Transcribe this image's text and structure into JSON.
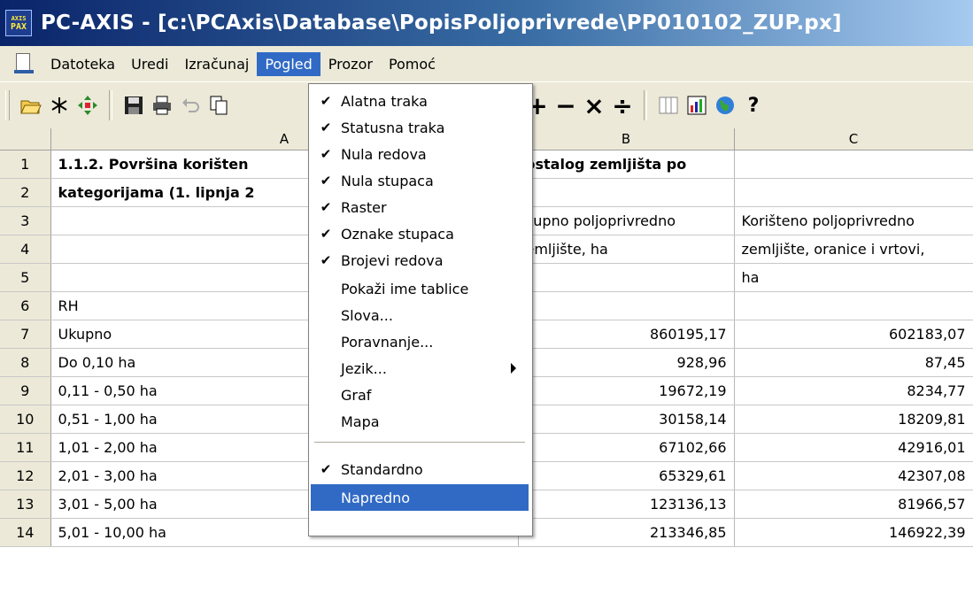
{
  "window": {
    "icon_text_top": "AXIS",
    "icon_text_bottom": "PAX",
    "title": "PC-AXIS - [c:\\PCAxis\\Database\\PopisPoljoprivrede\\PP010102_ZUP.px]"
  },
  "menubar": {
    "items": [
      "Datoteka",
      "Uredi",
      "Izračunaj",
      "Pogled",
      "Prozor",
      "Pomoć"
    ],
    "active": "Pogled"
  },
  "toolbar": {
    "text_buttons": {
      "percent": "%",
      "permille": "‰",
      "plus": "+",
      "minus": "−",
      "multiply": "×",
      "divide": "÷",
      "help": "?"
    }
  },
  "grid": {
    "column_headers": [
      "A",
      "B",
      "C"
    ],
    "rows": [
      {
        "n": "1",
        "a": "1.1.2. Površina korišten",
        "b": "ostalog zemljišta po",
        "c": "",
        "bold": true
      },
      {
        "n": "2",
        "a": "kategorijama (1. lipnja 2",
        "b": "",
        "c": "",
        "bold": true
      },
      {
        "n": "3",
        "a": "",
        "b": "kupno poljoprivredno",
        "c": "Korišteno poljoprivredno",
        "bold": false
      },
      {
        "n": "4",
        "a": "",
        "b": "emljište, ha",
        "c": "zemljište, oranice i vrtovi,",
        "bold": false
      },
      {
        "n": "5",
        "a": "",
        "b": "",
        "c": "ha",
        "bold": false
      },
      {
        "n": "6",
        "a": "RH",
        "b": "",
        "c": "",
        "bold": false
      },
      {
        "n": "7",
        "a": "Ukupno",
        "b": "860195,17",
        "c": "602183,07",
        "bold": false
      },
      {
        "n": "8",
        "a": "Do 0,10 ha",
        "b": "928,96",
        "c": "87,45",
        "bold": false
      },
      {
        "n": "9",
        "a": "0,11 - 0,50 ha",
        "b": "19672,19",
        "c": "8234,77",
        "bold": false
      },
      {
        "n": "10",
        "a": "0,51 - 1,00 ha",
        "b": "30158,14",
        "c": "18209,81",
        "bold": false
      },
      {
        "n": "11",
        "a": "1,01 - 2,00 ha",
        "b": "67102,66",
        "c": "42916,01",
        "bold": false
      },
      {
        "n": "12",
        "a": "2,01 - 3,00 ha",
        "b": "65329,61",
        "c": "42307,08",
        "bold": false
      },
      {
        "n": "13",
        "a": "3,01 - 5,00 ha",
        "b": "123136,13",
        "c": "81966,57",
        "bold": false
      },
      {
        "n": "14",
        "a": "5,01 - 10,00 ha",
        "b": "213346,85",
        "c": "146922,39",
        "bold": false
      }
    ]
  },
  "dropdown": {
    "check_glyph": "✔",
    "items": [
      {
        "label": "Alatna traka",
        "checked": true
      },
      {
        "label": "Statusna traka",
        "checked": true
      },
      {
        "label": "Nula redova",
        "checked": true
      },
      {
        "label": "Nula stupaca",
        "checked": true
      },
      {
        "label": "Raster",
        "checked": true
      },
      {
        "label": "Oznake stupaca",
        "checked": true
      },
      {
        "label": "Brojevi redova",
        "checked": true
      },
      {
        "label": "Pokaži ime tablice",
        "checked": false
      },
      {
        "label": "Slova...",
        "checked": false
      },
      {
        "label": "Poravnanje...",
        "checked": false
      },
      {
        "label": "Jezik...",
        "checked": false,
        "submenu": true
      },
      {
        "label": "Graf",
        "checked": false
      },
      {
        "label": "Mapa",
        "checked": false
      },
      {
        "label": "Standardno",
        "checked": true
      },
      {
        "label": "Napredno",
        "checked": false,
        "highlighted": true
      }
    ]
  }
}
